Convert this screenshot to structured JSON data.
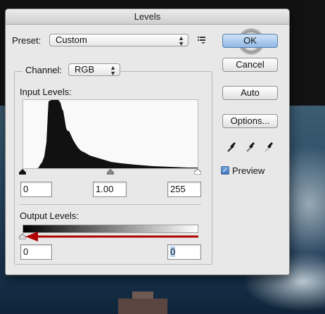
{
  "dialog": {
    "title": "Levels",
    "preset": {
      "label": "Preset:",
      "value": "Custom"
    },
    "channel": {
      "label": "Channel:",
      "value": "RGB"
    },
    "input_levels": {
      "label": "Input Levels:",
      "black": "0",
      "gamma": "1.00",
      "white": "255"
    },
    "output_levels": {
      "label": "Output Levels:",
      "black": "0",
      "white": "0"
    },
    "buttons": {
      "ok": "OK",
      "cancel": "Cancel",
      "auto": "Auto",
      "options": "Options..."
    },
    "preview": {
      "label": "Preview",
      "checked": true
    }
  },
  "icons": {
    "preset_menu": "preset-options-icon",
    "eyedroppers": [
      "black-eyedropper-icon",
      "gray-eyedropper-icon",
      "white-eyedropper-icon"
    ]
  },
  "colors": {
    "accent": "#8fb8e4",
    "annotation_arrow": "#b00000"
  }
}
